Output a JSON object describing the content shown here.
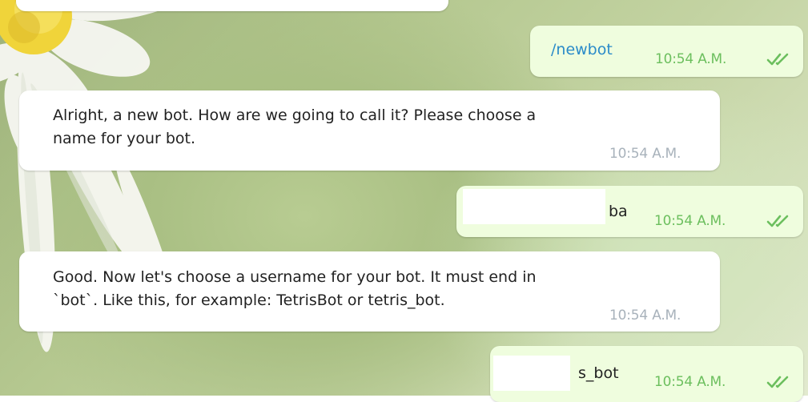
{
  "chat": {
    "messages": [
      {
        "direction": "outgoing",
        "text": "/newbot",
        "time": "10:54 A.M.",
        "status": "read-double-check-icon"
      },
      {
        "direction": "incoming",
        "line1": "Alright, a new bot. How are we going to call it? Please choose a",
        "line2": "name for your bot.",
        "time": "10:54 A.M."
      },
      {
        "direction": "outgoing",
        "text": "ba",
        "time": "10:54 A.M.",
        "status": "read-double-check-icon"
      },
      {
        "direction": "incoming",
        "line1": "Good. Now let's choose a username for your bot. It must end in",
        "line2": "`bot`. Like this, for example: TetrisBot or tetris_bot.",
        "time": "10:54 A.M."
      },
      {
        "direction": "outgoing",
        "text": "s_bot",
        "time": "10:54 A.M.",
        "status": "read-double-check-icon"
      }
    ]
  },
  "colors": {
    "outgoing_bubble": "#effdde",
    "incoming_bubble": "#ffffff",
    "outgoing_time": "#6cbf5e",
    "incoming_time": "#a8b2bb",
    "command_link": "#2a8bc9"
  }
}
